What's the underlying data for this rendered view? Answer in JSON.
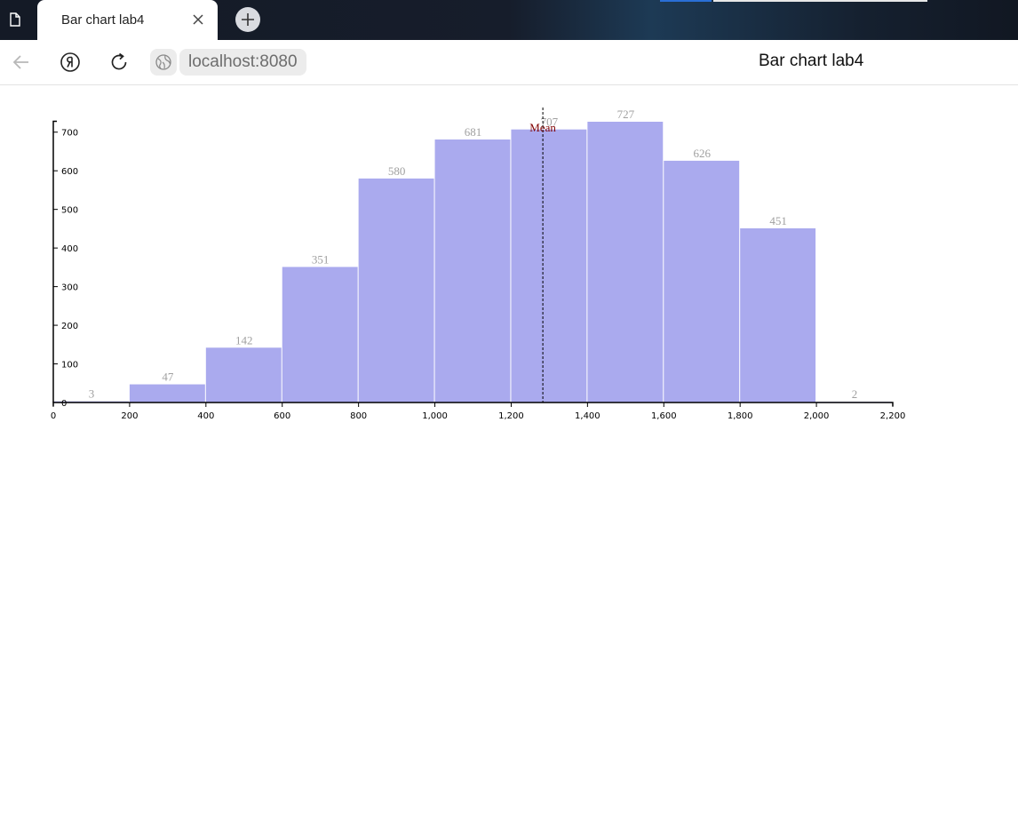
{
  "browser": {
    "tab_title": "Bar chart lab4",
    "url": "localhost:8080",
    "page_title": "Bar chart lab4",
    "colors": {
      "strip": "#161d2b",
      "accent": "#2a6fd6"
    }
  },
  "chart_data": {
    "type": "bar",
    "bins": [
      [
        0,
        200
      ],
      [
        200,
        400
      ],
      [
        400,
        600
      ],
      [
        600,
        800
      ],
      [
        800,
        1000
      ],
      [
        1000,
        1200
      ],
      [
        1200,
        1400
      ],
      [
        1400,
        1600
      ],
      [
        1600,
        1800
      ],
      [
        1800,
        2000
      ],
      [
        2000,
        2200
      ]
    ],
    "values": [
      3,
      47,
      142,
      351,
      580,
      681,
      707,
      727,
      626,
      451,
      2
    ],
    "value_labels": [
      "3",
      "47",
      "142",
      "351",
      "580",
      "681",
      "707",
      "727",
      "626",
      "451",
      "2"
    ],
    "x_ticks": [
      "0",
      "200",
      "400",
      "600",
      "800",
      "1,000",
      "1,200",
      "1,400",
      "1,600",
      "1,800",
      "2,000",
      "2,200"
    ],
    "y_ticks": [
      "0",
      "100",
      "200",
      "300",
      "400",
      "500",
      "600",
      "700"
    ],
    "xlim": [
      0,
      2200
    ],
    "ylim": [
      0,
      727
    ],
    "mean": 1283,
    "mean_label": "Mean",
    "title": "",
    "xlabel": "",
    "ylabel": "",
    "bar_color": "#aaaaee",
    "mean_color": "#800000",
    "label_color": "#a0a0a0",
    "grid": false
  }
}
